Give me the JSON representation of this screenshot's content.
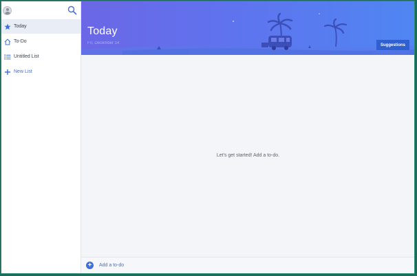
{
  "sidebar": {
    "items": [
      {
        "label": "Today",
        "icon": "star-icon"
      },
      {
        "label": "To-Do",
        "icon": "house-icon"
      },
      {
        "label": "Untitled List",
        "icon": "list-icon"
      },
      {
        "label": "New List",
        "icon": "plus-icon"
      }
    ]
  },
  "header": {
    "title": "Today",
    "date": "Fri, December 14",
    "suggestions_label": "Suggestions"
  },
  "main": {
    "empty_message": "Let's get started! Add a to-do.",
    "add_todo_label": "Add a to-do"
  },
  "colors": {
    "accent": "#3f6fd8",
    "header_gradient_start": "#6b67e6",
    "header_gradient_end": "#4f86f2"
  }
}
